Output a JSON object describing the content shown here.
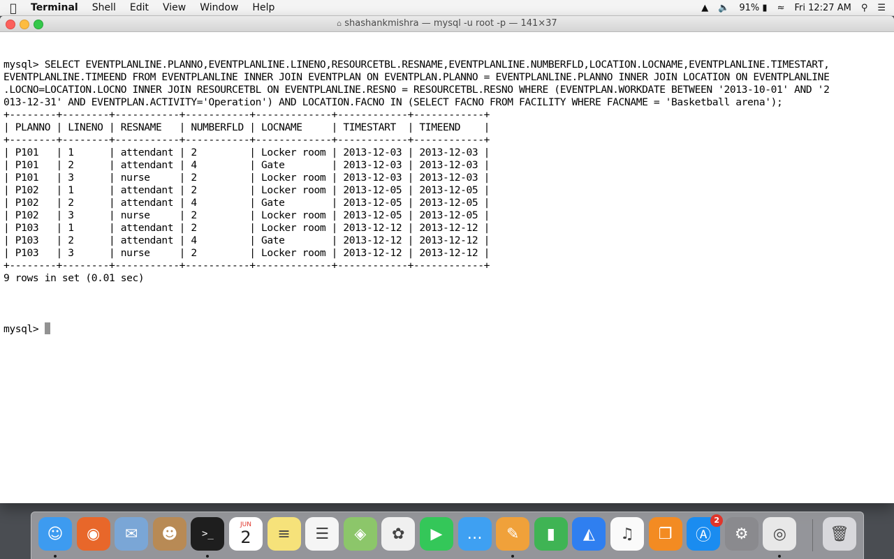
{
  "menubar": {
    "apple": "",
    "items": [
      "Terminal",
      "Shell",
      "Edit",
      "View",
      "Window",
      "Help"
    ],
    "battery": "91%",
    "clock": "Fri 12:27 AM"
  },
  "window": {
    "title": "shashankmishra — mysql -u root -p — 141×37"
  },
  "terminal": {
    "lines": [
      "mysql> SELECT EVENTPLANLINE.PLANNO,EVENTPLANLINE.LINENO,RESOURCETBL.RESNAME,EVENTPLANLINE.NUMBERFLD,LOCATION.LOCNAME,EVENTPLANLINE.TIMESTART,",
      "EVENTPLANLINE.TIMEEND FROM EVENTPLANLINE INNER JOIN EVENTPLAN ON EVENTPLAN.PLANNO = EVENTPLANLINE.PLANNO INNER JOIN LOCATION ON EVENTPLANLINE",
      ".LOCNO=LOCATION.LOCNO INNER JOIN RESOURCETBL ON EVENTPLANLINE.RESNO = RESOURCETBL.RESNO WHERE (EVENTPLAN.WORKDATE BETWEEN '2013-10-01' AND '2",
      "013-12-31' AND EVENTPLAN.ACTIVITY='Operation') AND LOCATION.FACNO IN (SELECT FACNO FROM FACILITY WHERE FACNAME = 'Basketball arena');",
      "+--------+--------+-----------+-----------+-------------+------------+------------+",
      "| PLANNO | LINENO | RESNAME   | NUMBERFLD | LOCNAME     | TIMESTART  | TIMEEND    |",
      "+--------+--------+-----------+-----------+-------------+------------+------------+",
      "| P101   | 1      | attendant | 2         | Locker room | 2013-12-03 | 2013-12-03 |",
      "| P101   | 2      | attendant | 4         | Gate        | 2013-12-03 | 2013-12-03 |",
      "| P101   | 3      | nurse     | 2         | Locker room | 2013-12-03 | 2013-12-03 |",
      "| P102   | 1      | attendant | 2         | Locker room | 2013-12-05 | 2013-12-05 |",
      "| P102   | 2      | attendant | 4         | Gate        | 2013-12-05 | 2013-12-05 |",
      "| P102   | 3      | nurse     | 2         | Locker room | 2013-12-05 | 2013-12-05 |",
      "| P103   | 1      | attendant | 2         | Locker room | 2013-12-12 | 2013-12-12 |",
      "| P103   | 2      | attendant | 4         | Gate        | 2013-12-12 | 2013-12-12 |",
      "| P103   | 3      | nurse     | 2         | Locker room | 2013-12-12 | 2013-12-12 |",
      "+--------+--------+-----------+-----------+-------------+------------+------------+",
      "9 rows in set (0.01 sec)",
      ""
    ],
    "prompt": "mysql> "
  },
  "dock": {
    "calendar_month": "JUN",
    "calendar_day": "2",
    "terminal_glyph": ">_",
    "appstore_badge": "2",
    "icons": [
      {
        "name": "finder-icon",
        "bg": "#3d9bf0",
        "glyph": "☺",
        "running": true
      },
      {
        "name": "firefox-icon",
        "bg": "#e8672a",
        "glyph": "◉",
        "running": false
      },
      {
        "name": "mail-icon",
        "bg": "#7aa6d6",
        "glyph": "✉",
        "running": false
      },
      {
        "name": "contacts-icon",
        "bg": "#b88a55",
        "glyph": "☻",
        "running": false
      },
      {
        "name": "terminal-icon",
        "bg": "#1e1e1e",
        "glyph": ">_",
        "running": true
      },
      {
        "name": "calendar-icon",
        "bg": "#ffffff",
        "glyph": "",
        "running": false
      },
      {
        "name": "notes-icon",
        "bg": "#f6e27a",
        "glyph": "≡",
        "running": false
      },
      {
        "name": "reminders-icon",
        "bg": "#f5f5f5",
        "glyph": "☰",
        "running": false
      },
      {
        "name": "maps-icon",
        "bg": "#8cc66a",
        "glyph": "◈",
        "running": false
      },
      {
        "name": "photos-icon",
        "bg": "#f0f0f0",
        "glyph": "✿",
        "running": false
      },
      {
        "name": "facetime-icon",
        "bg": "#34c759",
        "glyph": "▶",
        "running": false
      },
      {
        "name": "messages-icon",
        "bg": "#3ea0f2",
        "glyph": "…",
        "running": false
      },
      {
        "name": "pages-icon",
        "bg": "#f0a13a",
        "glyph": "✎",
        "running": true
      },
      {
        "name": "numbers-icon",
        "bg": "#3fb454",
        "glyph": "▮",
        "running": false
      },
      {
        "name": "keynote-icon",
        "bg": "#2f7ff0",
        "glyph": "◭",
        "running": false
      },
      {
        "name": "itunes-icon",
        "bg": "#fafafa",
        "glyph": "♫",
        "running": false
      },
      {
        "name": "ibooks-icon",
        "bg": "#f38b22",
        "glyph": "❐",
        "running": false
      },
      {
        "name": "app-store-icon",
        "bg": "#1a8cf0",
        "glyph": "Ⓐ",
        "running": false
      },
      {
        "name": "system-preferences-icon",
        "bg": "#8a8a8e",
        "glyph": "⚙",
        "running": false
      },
      {
        "name": "chrome-icon",
        "bg": "#e8e8e8",
        "glyph": "◎",
        "running": true
      },
      {
        "name": "trash-icon",
        "bg": "#d8d8dc",
        "glyph": "🗑",
        "running": false
      }
    ]
  }
}
